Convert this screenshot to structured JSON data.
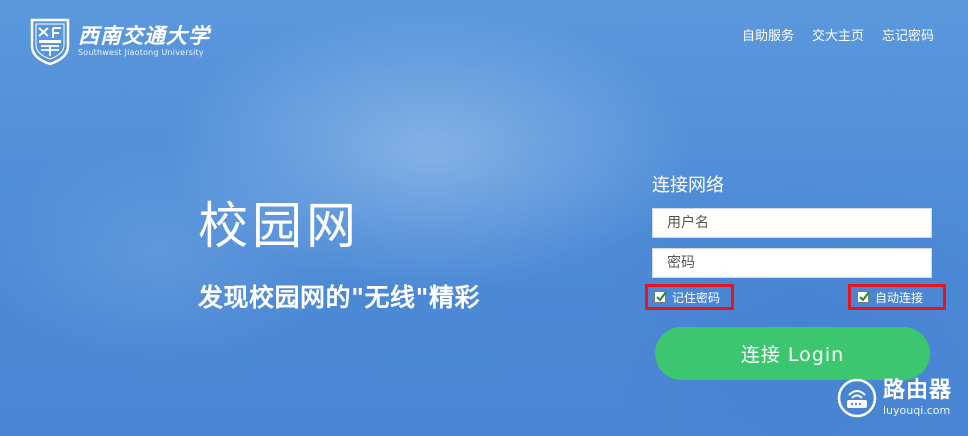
{
  "header": {
    "logo_cn": "西南交通大学",
    "logo_en": "Southwest Jiaotong University",
    "nav": [
      {
        "label": "自助服务"
      },
      {
        "label": "交大主页"
      },
      {
        "label": "忘记密码"
      }
    ]
  },
  "hero": {
    "title": "校园网",
    "subtitle": "发现校园网的\"无线\"精彩"
  },
  "login": {
    "title": "连接网络",
    "username_placeholder": "用户名",
    "password_placeholder": "密码",
    "remember_label": "记住密码",
    "remember_checked": true,
    "auto_label": "自动连接",
    "auto_checked": true,
    "button_label": "连接 Login"
  },
  "watermark": {
    "cn": "路由器",
    "en": "luyouqi.com"
  },
  "colors": {
    "background": "#4d8ad6",
    "button": "#3cc66f",
    "highlight_border": "#e8141d"
  },
  "icons": {
    "logo": "university-emblem-icon",
    "checkbox": "checkmark-icon",
    "watermark": "router-icon"
  }
}
